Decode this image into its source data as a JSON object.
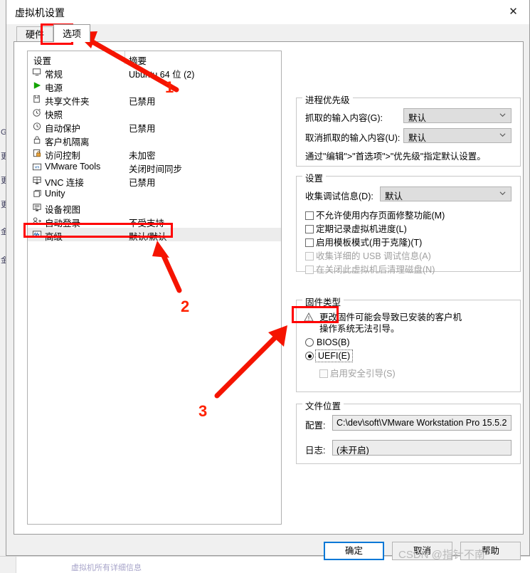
{
  "window": {
    "title": "虚拟机设置",
    "close_icon": "close-icon"
  },
  "tabs": [
    {
      "label": "硬件",
      "selected": false
    },
    {
      "label": "选项",
      "selected": true
    }
  ],
  "settings_list": {
    "columns": [
      "设置",
      "摘要"
    ],
    "rows": [
      {
        "icon": "monitor-icon",
        "label": "常规",
        "summary": "Ubuntu 64 位 (2)",
        "selected": false
      },
      {
        "icon": "power-play-icon",
        "label": "电源",
        "summary": "",
        "selected": false
      },
      {
        "icon": "folder-share-icon",
        "label": "共享文件夹",
        "summary": "已禁用",
        "selected": false
      },
      {
        "icon": "snapshot-clock-icon",
        "label": "快照",
        "summary": "",
        "selected": false
      },
      {
        "icon": "autoprotect-clock-icon",
        "label": "自动保护",
        "summary": "已禁用",
        "selected": false
      },
      {
        "icon": "lock-icon",
        "label": "客户机隔离",
        "summary": "",
        "selected": false
      },
      {
        "icon": "access-lock-icon",
        "label": "访问控制",
        "summary": "未加密",
        "selected": false
      },
      {
        "icon": "vmware-tools-icon",
        "label": "VMware Tools",
        "summary": "关闭时间同步",
        "selected": false
      },
      {
        "icon": "vnc-icon",
        "label": "VNC 连接",
        "summary": "已禁用",
        "selected": false
      },
      {
        "icon": "unity-icon",
        "label": "Unity",
        "summary": "",
        "selected": false
      },
      {
        "icon": "device-view-icon",
        "label": "设备视图",
        "summary": "",
        "selected": false
      },
      {
        "icon": "auto-login-icon",
        "label": "自动登录",
        "summary": "不受支持",
        "selected": false
      },
      {
        "icon": "advanced-wave-icon",
        "label": "高级",
        "summary": "默认/默认",
        "selected": true
      }
    ]
  },
  "process_priority": {
    "title": "进程优先级",
    "grab_label": "抓取的输入内容(G):",
    "grab_value": "默认",
    "ungrab_label": "取消抓取的输入内容(U):",
    "ungrab_value": "默认",
    "hint": "通过\"编辑\">\"首选项\">\"优先级\"指定默认设置。"
  },
  "settings_group": {
    "title": "设置",
    "debug_label": "收集调试信息(D):",
    "debug_value": "默认",
    "checkboxes": [
      {
        "label": "不允许使用内存页面修整功能(M)",
        "checked": false,
        "disabled": false
      },
      {
        "label": "定期记录虚拟机进度(L)",
        "checked": false,
        "disabled": false
      },
      {
        "label": "启用模板模式(用于克隆)(T)",
        "checked": false,
        "disabled": false
      },
      {
        "label": "收集详细的 USB 调试信息(A)",
        "checked": false,
        "disabled": true
      },
      {
        "label": "在关闭此虚拟机后清理磁盘(N)",
        "checked": false,
        "disabled": true
      }
    ]
  },
  "firmware": {
    "title": "固件类型",
    "warning_icon": "warning-triangle-icon",
    "warning_line1": "更改固件可能会导致已安装的客户机",
    "warning_line2": "操作系统无法引导。",
    "options": [
      {
        "label": "BIOS(B)",
        "checked": false
      },
      {
        "label": "UEFI(E)",
        "checked": true
      }
    ],
    "secure_boot": {
      "label": "启用安全引导(S)",
      "checked": false,
      "disabled": true
    }
  },
  "file_location": {
    "title": "文件位置",
    "config_label": "配置:",
    "config_value": "C:\\dev\\soft\\VMware Workstation Pro 15.5.2",
    "log_label": "日志:",
    "log_value": "(未开启)"
  },
  "buttons": {
    "ok": "确定",
    "cancel": "取消",
    "help": "帮助"
  },
  "annotations": {
    "numbers": [
      "1",
      "2",
      "3"
    ],
    "accent_color": "#ff0000"
  },
  "watermark": "CSDN @指针不南",
  "background": {
    "fragments": [
      "GB",
      "更",
      "更",
      "更",
      "金",
      "金"
    ],
    "bottom_text": "虚拟机所有详细信息"
  }
}
